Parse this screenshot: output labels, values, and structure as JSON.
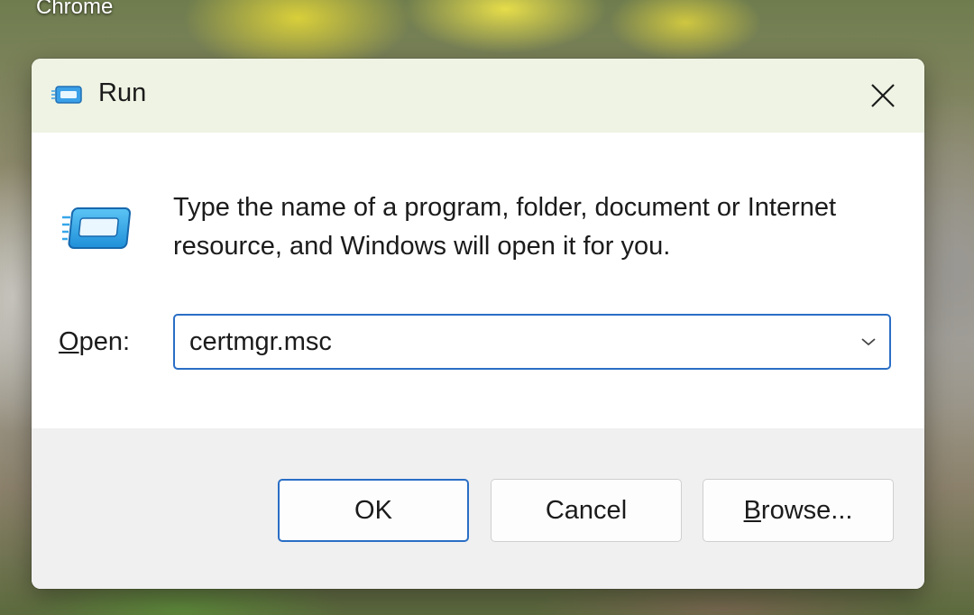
{
  "desktop": {
    "shortcut_label": "Chrome"
  },
  "dialog": {
    "title": "Run",
    "icon": "run-icon",
    "description": "Type the name of a program, folder, document or Internet resource, and Windows will open it for you.",
    "open_label_accel": "O",
    "open_label_rest": "pen:",
    "open_value": "certmgr.msc",
    "buttons": {
      "ok": "OK",
      "cancel": "Cancel",
      "browse_accel": "B",
      "browse_rest": "rowse..."
    },
    "colors": {
      "accent": "#2a6ec5",
      "titlebar": "#eef3e3",
      "footer": "#f0f0f0"
    }
  }
}
